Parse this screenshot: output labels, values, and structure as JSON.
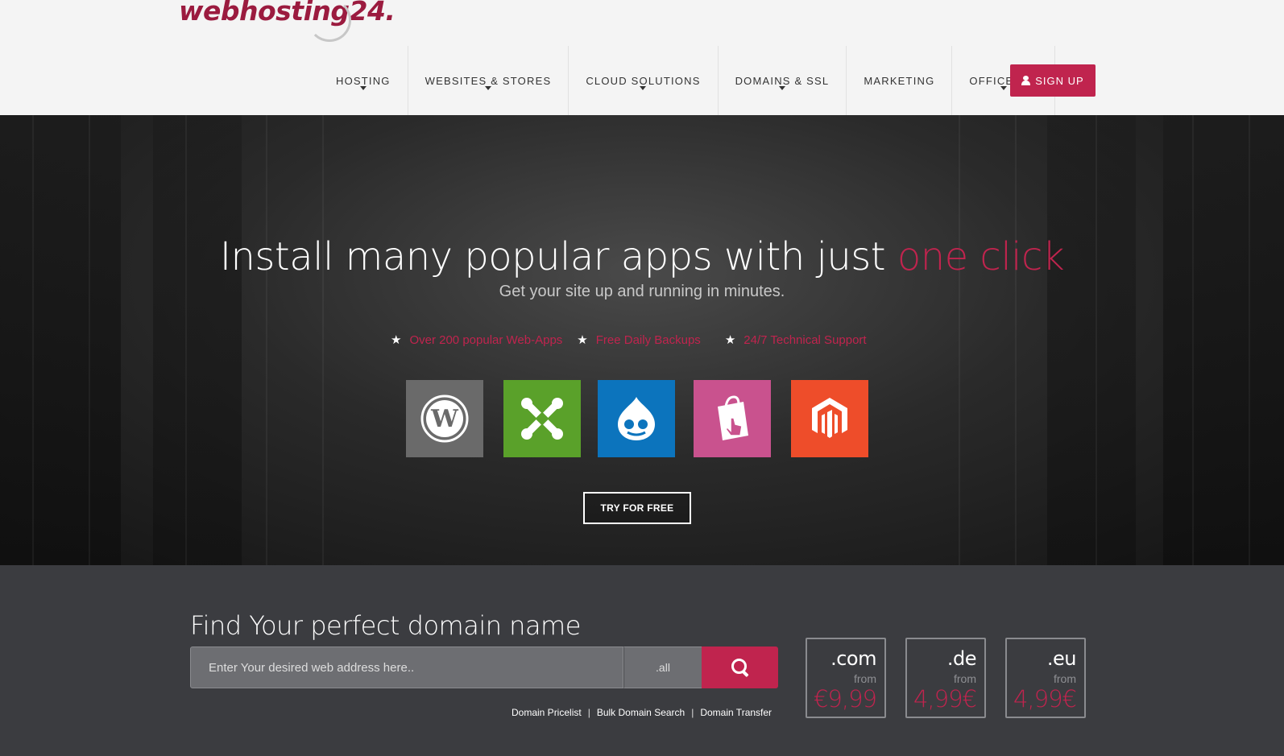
{
  "header": {
    "logo_text": "webhosting24.",
    "nav": [
      {
        "label": "HOSTING",
        "dropdown": true
      },
      {
        "label": "WEBSITES & STORES",
        "dropdown": true
      },
      {
        "label": "CLOUD SOLUTIONS",
        "dropdown": true
      },
      {
        "label": "DOMAINS & SSL",
        "dropdown": true
      },
      {
        "label": "MARKETING",
        "dropdown": false
      },
      {
        "label": "OFFICE 365",
        "dropdown": true
      }
    ],
    "signup_label": "SIGN UP"
  },
  "hero": {
    "title_main": "Install many popular apps with just ",
    "title_accent": "one click",
    "subtitle": "Get your site up and running in minutes.",
    "features": [
      "Over 200 popular Web-Apps",
      "Free Daily Backups",
      "24/7 Technical Support"
    ],
    "apps": [
      {
        "icon": "wordpress-icon",
        "color": "#6a6a6a"
      },
      {
        "icon": "joomla-icon",
        "color": "#5aa12a"
      },
      {
        "icon": "drupal-icon",
        "color": "#0c74bd"
      },
      {
        "icon": "prestashop-icon",
        "color": "#c9528e"
      },
      {
        "icon": "magento-icon",
        "color": "#ee4d2a"
      }
    ],
    "cta_label": "TRY FOR FREE"
  },
  "domain": {
    "title": "Find Your perfect domain name",
    "search_placeholder": "Enter Your desired web address here..",
    "tld_selected": ".all",
    "links": [
      "Domain Pricelist",
      "Bulk Domain Search",
      "Domain Transfer"
    ],
    "link_separator": "|",
    "tlds": [
      {
        "tld": ".com",
        "from": "from",
        "price": "€9,99"
      },
      {
        "tld": ".de",
        "from": "from",
        "price": "4,99€"
      },
      {
        "tld": ".eu",
        "from": "from",
        "price": "4,99€"
      }
    ]
  },
  "colors": {
    "brand": "#c0244e",
    "header_bg": "#f4f4f4",
    "domain_bg": "#3b3c40"
  }
}
